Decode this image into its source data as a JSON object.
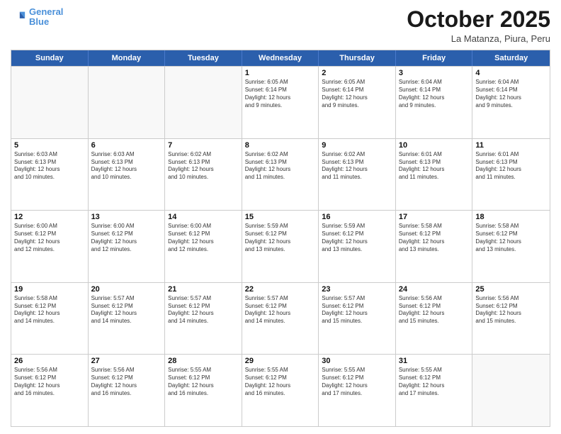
{
  "header": {
    "logo_line1": "General",
    "logo_line2": "Blue",
    "month": "October 2025",
    "location": "La Matanza, Piura, Peru"
  },
  "weekdays": [
    "Sunday",
    "Monday",
    "Tuesday",
    "Wednesday",
    "Thursday",
    "Friday",
    "Saturday"
  ],
  "rows": [
    [
      {
        "day": "",
        "text": ""
      },
      {
        "day": "",
        "text": ""
      },
      {
        "day": "",
        "text": ""
      },
      {
        "day": "1",
        "text": "Sunrise: 6:05 AM\nSunset: 6:14 PM\nDaylight: 12 hours\nand 9 minutes."
      },
      {
        "day": "2",
        "text": "Sunrise: 6:05 AM\nSunset: 6:14 PM\nDaylight: 12 hours\nand 9 minutes."
      },
      {
        "day": "3",
        "text": "Sunrise: 6:04 AM\nSunset: 6:14 PM\nDaylight: 12 hours\nand 9 minutes."
      },
      {
        "day": "4",
        "text": "Sunrise: 6:04 AM\nSunset: 6:14 PM\nDaylight: 12 hours\nand 9 minutes."
      }
    ],
    [
      {
        "day": "5",
        "text": "Sunrise: 6:03 AM\nSunset: 6:13 PM\nDaylight: 12 hours\nand 10 minutes."
      },
      {
        "day": "6",
        "text": "Sunrise: 6:03 AM\nSunset: 6:13 PM\nDaylight: 12 hours\nand 10 minutes."
      },
      {
        "day": "7",
        "text": "Sunrise: 6:02 AM\nSunset: 6:13 PM\nDaylight: 12 hours\nand 10 minutes."
      },
      {
        "day": "8",
        "text": "Sunrise: 6:02 AM\nSunset: 6:13 PM\nDaylight: 12 hours\nand 11 minutes."
      },
      {
        "day": "9",
        "text": "Sunrise: 6:02 AM\nSunset: 6:13 PM\nDaylight: 12 hours\nand 11 minutes."
      },
      {
        "day": "10",
        "text": "Sunrise: 6:01 AM\nSunset: 6:13 PM\nDaylight: 12 hours\nand 11 minutes."
      },
      {
        "day": "11",
        "text": "Sunrise: 6:01 AM\nSunset: 6:13 PM\nDaylight: 12 hours\nand 11 minutes."
      }
    ],
    [
      {
        "day": "12",
        "text": "Sunrise: 6:00 AM\nSunset: 6:12 PM\nDaylight: 12 hours\nand 12 minutes."
      },
      {
        "day": "13",
        "text": "Sunrise: 6:00 AM\nSunset: 6:12 PM\nDaylight: 12 hours\nand 12 minutes."
      },
      {
        "day": "14",
        "text": "Sunrise: 6:00 AM\nSunset: 6:12 PM\nDaylight: 12 hours\nand 12 minutes."
      },
      {
        "day": "15",
        "text": "Sunrise: 5:59 AM\nSunset: 6:12 PM\nDaylight: 12 hours\nand 13 minutes."
      },
      {
        "day": "16",
        "text": "Sunrise: 5:59 AM\nSunset: 6:12 PM\nDaylight: 12 hours\nand 13 minutes."
      },
      {
        "day": "17",
        "text": "Sunrise: 5:58 AM\nSunset: 6:12 PM\nDaylight: 12 hours\nand 13 minutes."
      },
      {
        "day": "18",
        "text": "Sunrise: 5:58 AM\nSunset: 6:12 PM\nDaylight: 12 hours\nand 13 minutes."
      }
    ],
    [
      {
        "day": "19",
        "text": "Sunrise: 5:58 AM\nSunset: 6:12 PM\nDaylight: 12 hours\nand 14 minutes."
      },
      {
        "day": "20",
        "text": "Sunrise: 5:57 AM\nSunset: 6:12 PM\nDaylight: 12 hours\nand 14 minutes."
      },
      {
        "day": "21",
        "text": "Sunrise: 5:57 AM\nSunset: 6:12 PM\nDaylight: 12 hours\nand 14 minutes."
      },
      {
        "day": "22",
        "text": "Sunrise: 5:57 AM\nSunset: 6:12 PM\nDaylight: 12 hours\nand 14 minutes."
      },
      {
        "day": "23",
        "text": "Sunrise: 5:57 AM\nSunset: 6:12 PM\nDaylight: 12 hours\nand 15 minutes."
      },
      {
        "day": "24",
        "text": "Sunrise: 5:56 AM\nSunset: 6:12 PM\nDaylight: 12 hours\nand 15 minutes."
      },
      {
        "day": "25",
        "text": "Sunrise: 5:56 AM\nSunset: 6:12 PM\nDaylight: 12 hours\nand 15 minutes."
      }
    ],
    [
      {
        "day": "26",
        "text": "Sunrise: 5:56 AM\nSunset: 6:12 PM\nDaylight: 12 hours\nand 16 minutes."
      },
      {
        "day": "27",
        "text": "Sunrise: 5:56 AM\nSunset: 6:12 PM\nDaylight: 12 hours\nand 16 minutes."
      },
      {
        "day": "28",
        "text": "Sunrise: 5:55 AM\nSunset: 6:12 PM\nDaylight: 12 hours\nand 16 minutes."
      },
      {
        "day": "29",
        "text": "Sunrise: 5:55 AM\nSunset: 6:12 PM\nDaylight: 12 hours\nand 16 minutes."
      },
      {
        "day": "30",
        "text": "Sunrise: 5:55 AM\nSunset: 6:12 PM\nDaylight: 12 hours\nand 17 minutes."
      },
      {
        "day": "31",
        "text": "Sunrise: 5:55 AM\nSunset: 6:12 PM\nDaylight: 12 hours\nand 17 minutes."
      },
      {
        "day": "",
        "text": ""
      }
    ]
  ]
}
